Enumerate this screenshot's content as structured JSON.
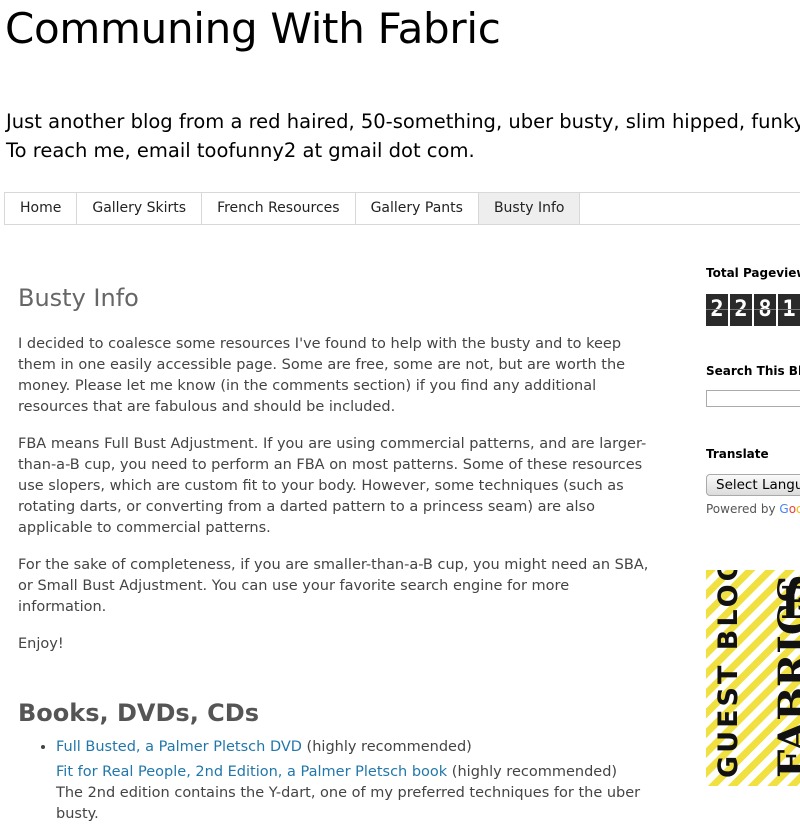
{
  "header": {
    "title": "Communing With Fabric",
    "description_line1": "Just another blog from a red haired, 50-something, uber busty, slim hipped, funky lo",
    "description_line2": "To reach me, email toofunny2 at gmail dot com."
  },
  "tabs": [
    {
      "label": "Home"
    },
    {
      "label": "Gallery Skirts"
    },
    {
      "label": "French Resources"
    },
    {
      "label": "Gallery Pants"
    },
    {
      "label": "Busty Info",
      "active": true
    }
  ],
  "post": {
    "title": "Busty Info",
    "paragraphs": [
      "I decided to coalesce some resources I've found to help with the busty and to keep them in one easily accessible page. Some are free, some are not, but are worth the money. Please let me know (in the comments section) if you find any additional resources that are fabulous and should be included.",
      "FBA means Full Bust Adjustment. If you are using commercial patterns, and are larger-than-a-B cup, you need to perform an FBA on most patterns. Some of these resources use slopers, which are custom fit to your body. However, some techniques (such as rotating darts, or converting from a darted pattern to a princess seam) are also applicable to commercial patterns.",
      "For the sake of completeness, if you are smaller-than-a-B cup, you might need an SBA, or Small Bust Adjustment. You can use your favorite search engine for more information.",
      "Enjoy!"
    ],
    "section_title": "Books, DVDs, CDs",
    "resources": {
      "item1_link": "Full Busted, a Palmer Pletsch DVD",
      "item1_note": " (highly recommended)",
      "item2_link": "Fit for Real People, 2nd Edition, a Palmer Pletsch book",
      "item2_note": " (highly recommended)",
      "item2_desc": "The 2nd edition contains the Y-dart, one of my preferred techniques for the uber busty."
    }
  },
  "sidebar": {
    "pageviews_title": "Total Pageviews",
    "pageview_digits": [
      "2",
      "2",
      "8",
      "1"
    ],
    "search_title": "Search This Blog",
    "translate_title": "Translate",
    "translate_select": "Select Langu",
    "powered_by": "Powered by ",
    "powered_brand": [
      "G",
      "o",
      "o"
    ],
    "badge_text": "GUEST BLOGGER FOR",
    "badge_brand": "FABRICS",
    "badge_big": "B",
    "colors": {
      "badge_yellow": "#f0e040",
      "link": "#2277aa"
    }
  }
}
